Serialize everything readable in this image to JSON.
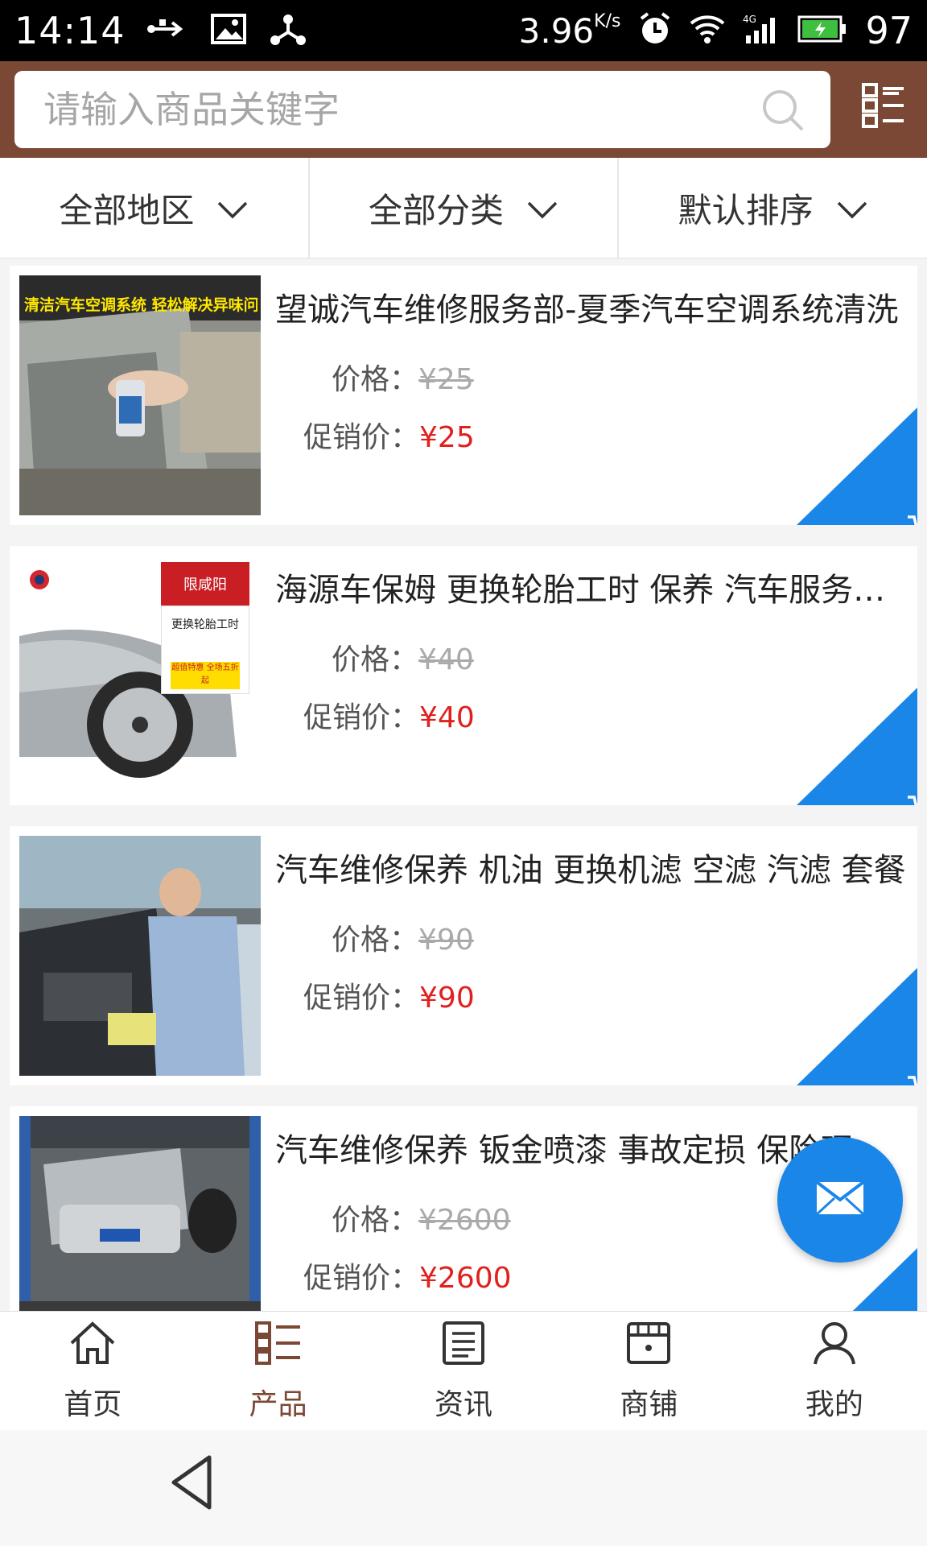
{
  "status_bar": {
    "time": "14:14",
    "speed": "3.96",
    "speed_unit": "K/s",
    "battery": "97",
    "icons": [
      "usb-icon",
      "image-icon",
      "share-icon",
      "alarm-icon",
      "wifi-icon",
      "signal-4g-icon",
      "battery-icon"
    ]
  },
  "search": {
    "placeholder": "请输入商品关键字"
  },
  "filters": [
    {
      "label": "全部地区"
    },
    {
      "label": "全部分类"
    },
    {
      "label": "默认排序"
    }
  ],
  "labels": {
    "price": "价格：",
    "promo_price": "促销价："
  },
  "products": [
    {
      "title": "望诚汽车维修服务部-夏季汽车空调系统清洗",
      "price": "¥25",
      "promo_price": "¥25",
      "thumb_banner": "清洁汽车空调系统 轻松解决异味问题"
    },
    {
      "title": "海源车保姆 更换轮胎工时 保养 汽车服务门店",
      "price": "¥40",
      "promo_price": "¥40",
      "badge_top": "限咸阳",
      "badge_mid": "更换轮胎工时",
      "badge_bottom": "超值特惠 全场五折起"
    },
    {
      "title": "汽车维修保养 机油 更换机滤 空滤 汽滤 套餐",
      "price": "¥90",
      "promo_price": "¥90"
    },
    {
      "title": "汽车维修保养 钣金喷漆 事故定损 保险理赔服务",
      "price": "¥2600",
      "promo_price": "¥2600"
    }
  ],
  "nav": [
    {
      "label": "首页",
      "icon": "home-icon"
    },
    {
      "label": "产品",
      "icon": "product-list-icon"
    },
    {
      "label": "资讯",
      "icon": "news-icon"
    },
    {
      "label": "商铺",
      "icon": "shop-icon"
    },
    {
      "label": "我的",
      "icon": "user-icon"
    }
  ],
  "colors": {
    "header": "#7b4835",
    "accent": "#1a86e8",
    "promo": "#e0201d",
    "active_nav": "#7b4835"
  }
}
